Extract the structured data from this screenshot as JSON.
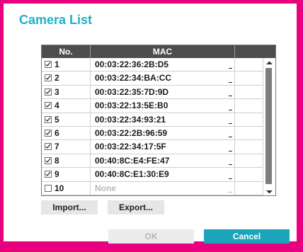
{
  "dialog": {
    "title": "Camera List"
  },
  "table": {
    "headers": {
      "no": "No.",
      "mac": "MAC"
    },
    "rows": [
      {
        "no": "1",
        "checked": true,
        "mac": "00:03:22:36:2B:D5",
        "enabled": true
      },
      {
        "no": "2",
        "checked": true,
        "mac": "00:03:22:34:BA:CC",
        "enabled": true
      },
      {
        "no": "3",
        "checked": true,
        "mac": "00:03:22:35:7D:9D",
        "enabled": true
      },
      {
        "no": "4",
        "checked": true,
        "mac": "00:03:22:13:5E:B0",
        "enabled": true
      },
      {
        "no": "5",
        "checked": true,
        "mac": "00:03:22:34:93:21",
        "enabled": true
      },
      {
        "no": "6",
        "checked": true,
        "mac": "00:03:22:2B:96:59",
        "enabled": true
      },
      {
        "no": "7",
        "checked": true,
        "mac": "00:03:22:34:17:5F",
        "enabled": true
      },
      {
        "no": "8",
        "checked": true,
        "mac": "00:40:8C:E4:FE:47",
        "enabled": true
      },
      {
        "no": "9",
        "checked": true,
        "mac": "00:40:8C:E1:30:E9",
        "enabled": true
      },
      {
        "no": "10",
        "checked": false,
        "mac": "None",
        "enabled": false
      }
    ]
  },
  "buttons": {
    "import": "Import...",
    "export": "Export...",
    "ok": "OK",
    "cancel": "Cancel"
  },
  "colors": {
    "frame": "#e9007e",
    "title": "#1fb0c8",
    "header_bg": "#4d4d4d",
    "primary_button": "#1aa5bb"
  }
}
